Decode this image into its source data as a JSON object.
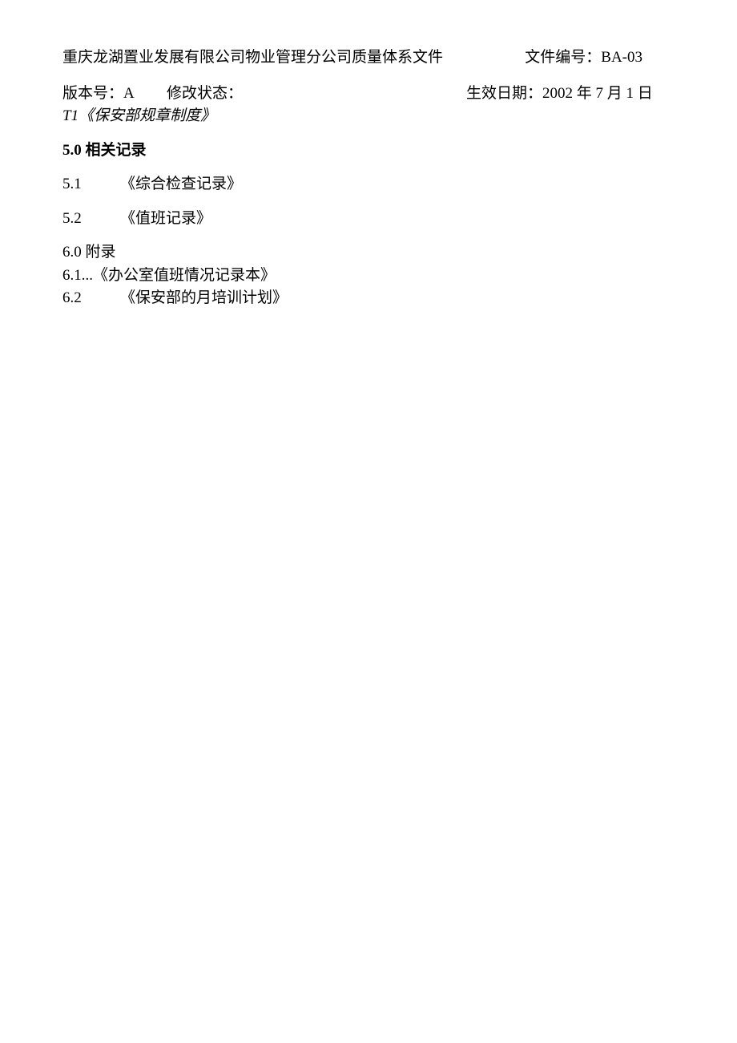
{
  "header": {
    "company_title": "重庆龙湖置业发展有限公司物业管理分公司质量体系文件",
    "doc_number_label": "文件编号：",
    "doc_number_value": "BA-03",
    "version_label": "版本号：",
    "version_value": "A",
    "modify_label": "修改状态：",
    "date_label": "生效日期：",
    "date_value": "2002 年 7 月 1 日"
  },
  "t1": {
    "prefix": "T1",
    "text": "《保安部规章制度》"
  },
  "section5": {
    "num": "5.0",
    "heading": " 相关记录",
    "items": [
      {
        "num": "5.1",
        "text": "《综合检查记录》"
      },
      {
        "num": "5.2",
        "text": "《值班记录》"
      }
    ]
  },
  "section6": {
    "line1_num": "6.0",
    "line1_text": " 附录",
    "line2_num": "6.1...",
    "line2_text": "《办公室值班情况记录本》",
    "line3_num": "6.2",
    "line3_text": "《保安部的月培训计划》"
  }
}
